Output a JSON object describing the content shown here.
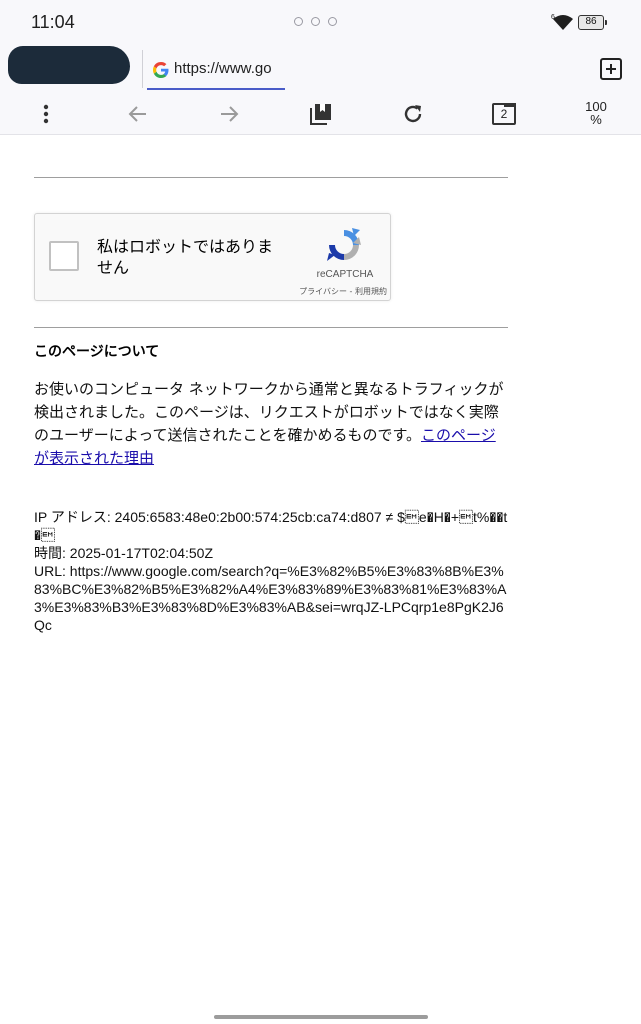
{
  "status_bar": {
    "time": "11:04",
    "wifi_badge": "6",
    "battery": "86"
  },
  "browser": {
    "url": "https://www.go",
    "tab_count": "2",
    "zoom": "100",
    "zoom_unit": "%"
  },
  "captcha": {
    "label": "私はロボットではありません",
    "brand": "reCAPTCHA",
    "privacy": "プライバシー",
    "separator": " - ",
    "terms": "利用規約"
  },
  "about": {
    "heading": "このページについて",
    "body": "お使いのコンピュータ ネットワークから通常と異なるトラフィックが検出されました。このページは、リクエストがロボットではなく実際のユーザーによって送信されたことを確かめるものです。",
    "link": "このページが表示された理由"
  },
  "info": {
    "ip": "IP アドレス: 2405:6583:48e0:2b00:574:25cb:ca74:d807 ≠ $\u0019e�H�+\u0019t%��t�\u0019",
    "time": "時間: 2025-01-17T02:04:50Z",
    "url": "URL: https://www.google.com/search?q=%E3%82%B5%E3%83%8B%E3%83%BC%E3%82%B5%E3%82%A4%E3%83%89%E3%83%81%E3%83%A3%E3%83%B3%E3%83%8D%E3%83%AB&sei=wrqJZ-LPCqrp1e8PgK2J6Qc"
  },
  "colors": {
    "link": "#1a0dab",
    "tab_underline": "#4a5cc8",
    "recaptcha_blue": "#4a90e2",
    "recaptcha_dark_blue": "#1c3aa9",
    "recaptcha_gray": "#b0b0b0"
  }
}
